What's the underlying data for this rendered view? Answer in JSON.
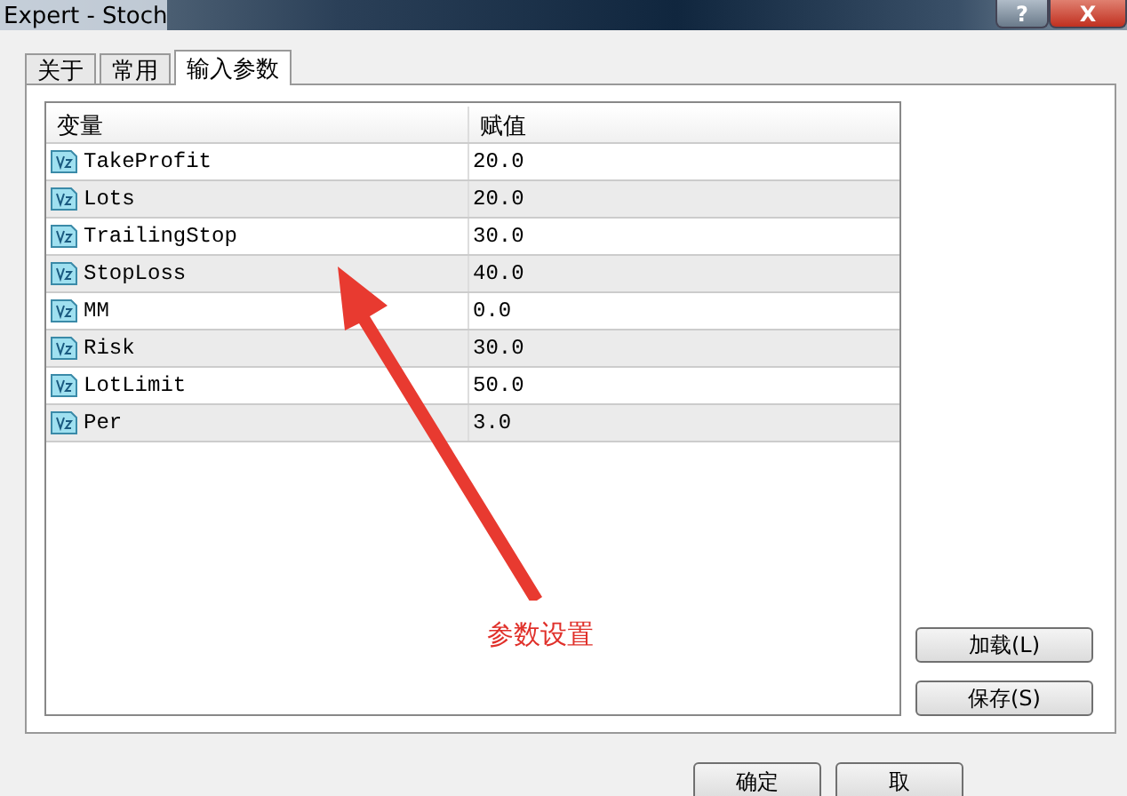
{
  "window": {
    "title": "Expert - Stoch",
    "help_button": "?",
    "close_button": "X"
  },
  "tabs": [
    {
      "label": "关于",
      "selected": false
    },
    {
      "label": "常用",
      "selected": false
    },
    {
      "label": "输入参数",
      "selected": true
    }
  ],
  "table": {
    "columns": [
      "变量",
      "赋值"
    ],
    "rows": [
      {
        "name": "TakeProfit",
        "value": "20.0"
      },
      {
        "name": "Lots",
        "value": "20.0"
      },
      {
        "name": "TrailingStop",
        "value": "30.0"
      },
      {
        "name": "StopLoss",
        "value": "40.0"
      },
      {
        "name": "MM",
        "value": "0.0"
      },
      {
        "name": "Risk",
        "value": "30.0"
      },
      {
        "name": "LotLimit",
        "value": "50.0"
      },
      {
        "name": "Per",
        "value": "3.0"
      }
    ]
  },
  "annotation": {
    "text": "参数设置"
  },
  "side_buttons": [
    "加载(L)",
    "保存(S)"
  ],
  "footer_buttons": [
    "确定",
    "取"
  ]
}
